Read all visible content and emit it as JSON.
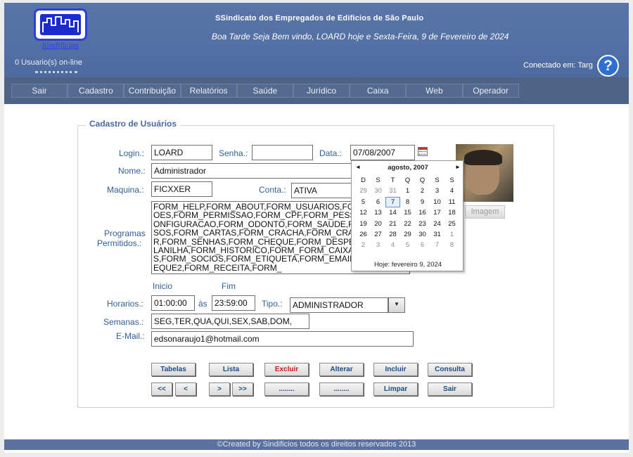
{
  "header": {
    "logo_caption": "Sindificios",
    "site_title": "SSindicato dos Empregados de Edificios de São Paulo",
    "welcome": "Boa Tarde Seja Bem vindo, LOARD hoje e Sexta-Feira, 9 de Fevereiro de 2024",
    "users_online": "0 Usuario(s) on-line",
    "connected_label": "Conectado em:",
    "connected_value": "Targ",
    "help_icon": "?"
  },
  "nav": [
    "Sair",
    "Cadastro",
    "Contribuição",
    "Relatórios",
    "Saúde",
    "Jurídico",
    "Caixa",
    "Web",
    "Operador"
  ],
  "form": {
    "legend": "Cadastro de Usuários",
    "login_label": "Login.:",
    "login_value": "LOARD",
    "senha_label": "Senha.:",
    "senha_value": "",
    "data_label": "Data.:",
    "data_value": "07/08/2007",
    "nome_label": "Nome.:",
    "nome_value": "Administrador",
    "maquina_label": "Maquina.:",
    "maquina_value": "FICXXER",
    "conta_label": "Conta.:",
    "conta_value": "ATIVA",
    "programas_label_1": "Programas",
    "programas_label_2": "Permitidos.:",
    "programas_value": "FORM_HELP,FORM_ABOUT,FORM_USUARIOS,FORM_OPERACOES,FORM_PERMISSAO,FORM_CPF,FORM_PESSOA,FORM_CONFIGURACAO,FORM_ODONTO,FORM_SAUDE,FORM_RECURSOS,FORM_CARTAS,FORM_CRACHA,FORM_CRACHA_PRINTER,FORM_SENHAS,FORM_CHEQUE,FORM_DESPESA,FORM_PLANILHA,FORM_HISTORICO,FORM_FORM_CAIXA,FORM_ADMS,FORM_SOCIOS,FORM_ETIQUETA,FORM_EMAILS,FORM_CHEQUE2,FORM_RECEITA,FORM_",
    "inicio_label": "Inicio",
    "fim_label": "Fim",
    "horarios_label": "Horarios.:",
    "horario_inicio": "01:00:00",
    "as_label": "às",
    "horario_fim": "23:59:00",
    "tipo_label": "Tipo.:",
    "tipo_value": "ADMINISTRADOR",
    "semanas_label": "Semanas.:",
    "semanas_value": "SEG,TER,QUA,QUI,SEX,SAB,DOM,",
    "email_label": "E-Mail.:",
    "email_value": "edsonaraujo1@hotmail.com",
    "imagem_button": "Imagem"
  },
  "buttons_row1": [
    "Tabelas",
    "Lista",
    "Excluir",
    "Alterar",
    "Incluir",
    "Consulta"
  ],
  "buttons_row2": [
    "<<",
    "<",
    ">",
    ">>",
    "........",
    "........",
    "Limpar",
    "Sair"
  ],
  "calendar": {
    "title": "agosto, 2007",
    "prev": "◄",
    "next": "►",
    "weekdays": [
      "D",
      "S",
      "T",
      "Q",
      "Q",
      "S",
      "S"
    ],
    "weeks": [
      [
        "29",
        "30",
        "31",
        "1",
        "2",
        "3",
        "4"
      ],
      [
        "5",
        "6",
        "7",
        "8",
        "9",
        "10",
        "11"
      ],
      [
        "12",
        "13",
        "14",
        "15",
        "16",
        "17",
        "18"
      ],
      [
        "19",
        "20",
        "21",
        "22",
        "23",
        "24",
        "25"
      ],
      [
        "26",
        "27",
        "28",
        "29",
        "30",
        "31",
        "1"
      ],
      [
        "2",
        "3",
        "4",
        "5",
        "6",
        "7",
        "8"
      ]
    ],
    "selected": "7",
    "today": "Hoje: fevereiro 9, 2024"
  },
  "footer": "©Created by Sindificios todos os direitos reservados 2013",
  "colors": {
    "header_bg": "#5a75a8",
    "nav_bg": "#4f6386",
    "label": "#2f5f9a",
    "button_text": "#1e4a86",
    "danger": "#c41818"
  }
}
